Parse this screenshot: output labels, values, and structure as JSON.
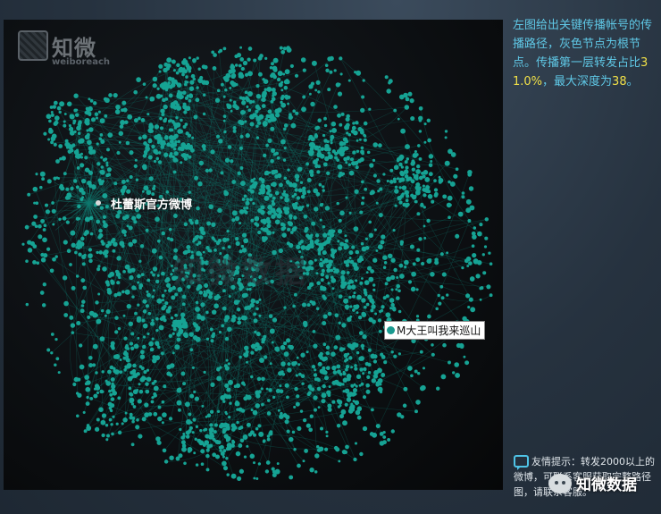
{
  "watermark": {
    "name": "知微",
    "sub": "weiboreach",
    "center": "知微数据"
  },
  "graph": {
    "root_label": "杜蕾斯官方微博",
    "secondary_label": "M大王叫我来巡山",
    "node_color": "#16a394",
    "edge_color": "#0f7a70",
    "root_color": "#d9d9d9"
  },
  "side": {
    "text_before": "左图给出关键传播帐号的传播路径，灰色节点为根节点。传播第一层转发占比",
    "percent": "31.0%",
    "text_middle": "，最大深度为",
    "depth": "38",
    "text_after": "。"
  },
  "tip": {
    "text": "友情提示：转发2000以上的微博，可联系客服获取完整路径图，请联系客服。"
  },
  "brand": {
    "name": "知微数据"
  },
  "colors": {
    "accent": "#5fc8e6",
    "highlight": "#f0e048"
  }
}
